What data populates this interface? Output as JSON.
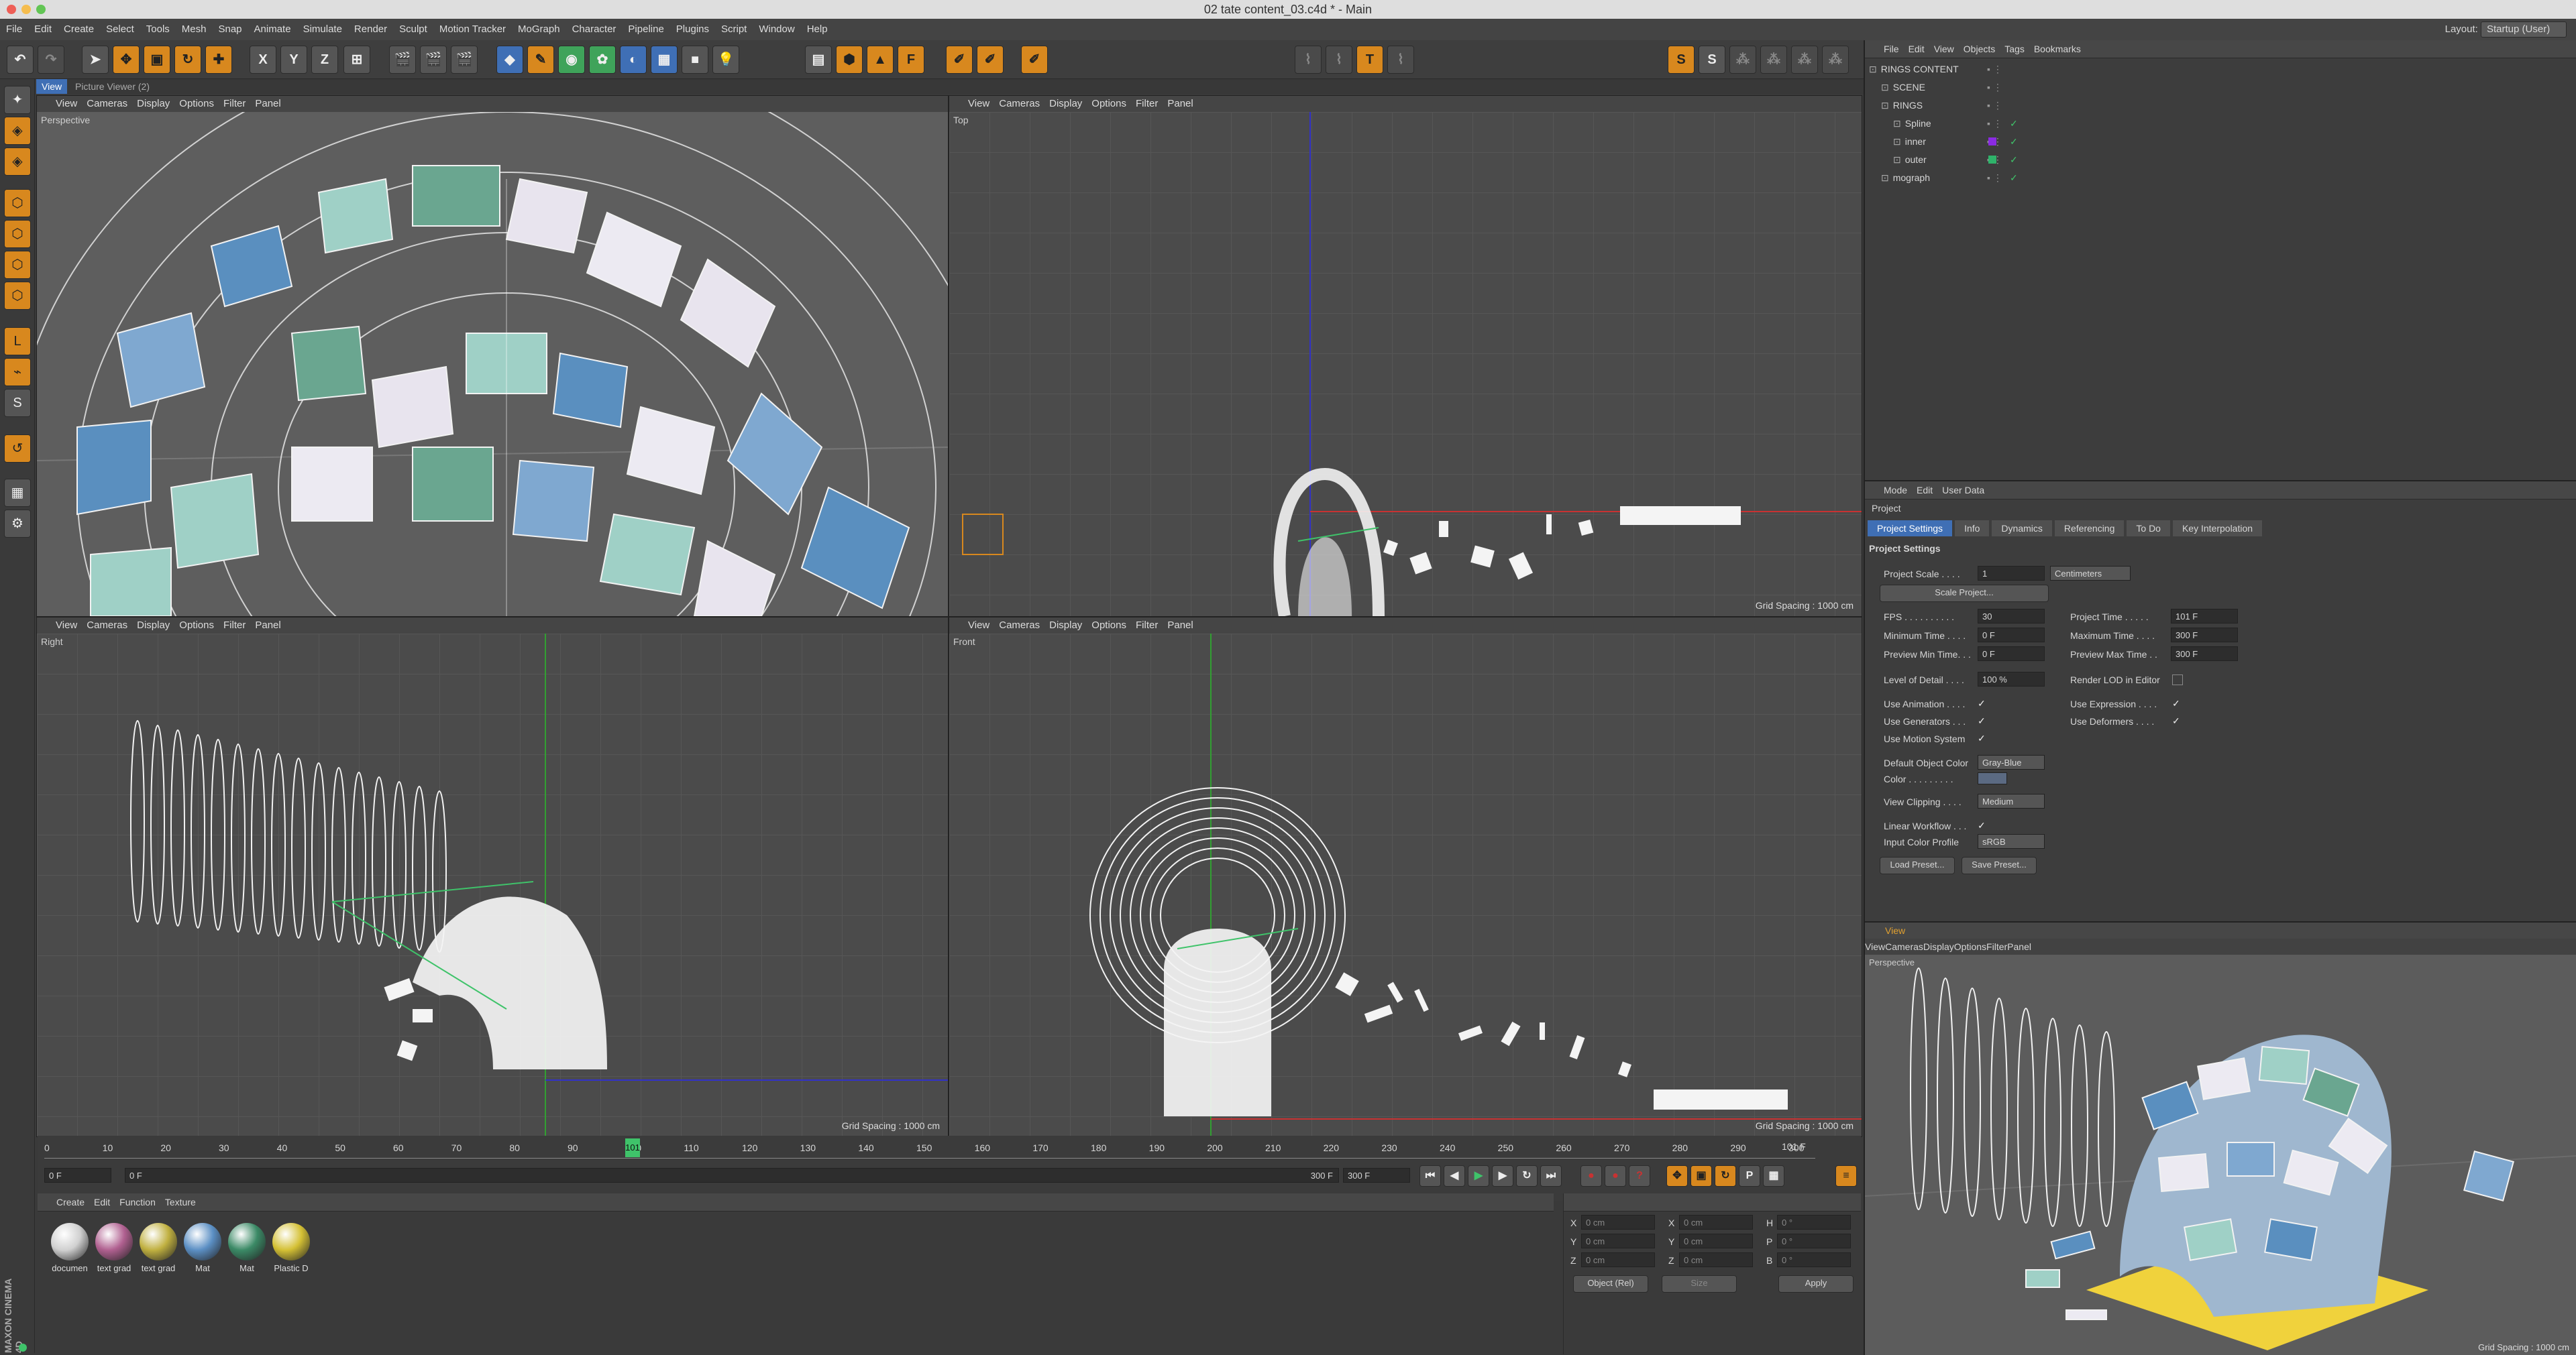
{
  "window": {
    "title": "02 tate content_03.c4d * - Main"
  },
  "menu": {
    "items": [
      "File",
      "Edit",
      "Create",
      "Select",
      "Tools",
      "Mesh",
      "Snap",
      "Animate",
      "Simulate",
      "Render",
      "Sculpt",
      "Motion Tracker",
      "MoGraph",
      "Character",
      "Pipeline",
      "Plugins",
      "Script",
      "Window",
      "Help"
    ],
    "layout_label": "Layout:",
    "layout_value": "Startup (User)"
  },
  "toolbar": {
    "axis_labels": [
      "X",
      "Y",
      "Z"
    ]
  },
  "viewport_tabs": {
    "view": "View",
    "picture_viewer": "Picture Viewer (2)"
  },
  "viewports": [
    {
      "name": "Perspective",
      "menu": [
        "View",
        "Cameras",
        "Display",
        "Options",
        "Filter",
        "Panel"
      ],
      "grid": ""
    },
    {
      "name": "Top",
      "menu": [
        "View",
        "Cameras",
        "Display",
        "Options",
        "Filter",
        "Panel"
      ],
      "grid": "Grid Spacing : 1000 cm"
    },
    {
      "name": "Right",
      "menu": [
        "View",
        "Cameras",
        "Display",
        "Options",
        "Filter",
        "Panel"
      ],
      "grid": "Grid Spacing : 1000 cm"
    },
    {
      "name": "Front",
      "menu": [
        "View",
        "Cameras",
        "Display",
        "Options",
        "Filter",
        "Panel"
      ],
      "grid": "Grid Spacing : 1000 cm"
    }
  ],
  "timeline": {
    "ticks": [
      "0",
      "10",
      "20",
      "30",
      "40",
      "50",
      "60",
      "70",
      "80",
      "90",
      "100",
      "110",
      "120",
      "130",
      "140",
      "150",
      "160",
      "170",
      "180",
      "190",
      "200",
      "210",
      "220",
      "230",
      "240",
      "250",
      "260",
      "270",
      "280",
      "290",
      "300"
    ],
    "current_marker": "101",
    "current_frame": "0 F",
    "start": "0 F",
    "end_field": "300 F",
    "end": "300 F",
    "right_readout": "101 F"
  },
  "materials": {
    "menu": [
      "Create",
      "Edit",
      "Function",
      "Texture"
    ],
    "items": [
      {
        "label": "documen",
        "color": "#d0d0d0"
      },
      {
        "label": "text grad",
        "color": "#b06090"
      },
      {
        "label": "text grad",
        "color": "#c0b040"
      },
      {
        "label": "Mat",
        "color": "#5b8fc4"
      },
      {
        "label": "Mat",
        "color": "#3b8a66"
      },
      {
        "label": "Plastic D",
        "color": "#d4c034"
      }
    ]
  },
  "coords": {
    "rows": [
      [
        "X",
        "0 cm",
        "X",
        "0 cm",
        "H",
        "0 °"
      ],
      [
        "Y",
        "0 cm",
        "Y",
        "0 cm",
        "P",
        "0 °"
      ],
      [
        "Z",
        "0 cm",
        "Z",
        "0 cm",
        "B",
        "0 °"
      ]
    ],
    "mode": "Object (Rel)",
    "size": "Size",
    "apply": "Apply"
  },
  "objects": {
    "menu": [
      "File",
      "Edit",
      "View",
      "Objects",
      "Tags",
      "Bookmarks"
    ],
    "items": [
      {
        "name": "RINGS CONTENT",
        "indent": 0
      },
      {
        "name": "SCENE",
        "indent": 1
      },
      {
        "name": "RINGS",
        "indent": 1
      },
      {
        "name": "Spline",
        "indent": 2
      },
      {
        "name": "inner",
        "indent": 2
      },
      {
        "name": "outer",
        "indent": 2
      },
      {
        "name": "mograph",
        "indent": 1
      }
    ]
  },
  "attributes": {
    "menu": [
      "Mode",
      "Edit",
      "User Data"
    ],
    "title": "Project",
    "tabs": [
      "Project Settings",
      "Info",
      "Dynamics",
      "Referencing",
      "To Do",
      "Key Interpolation"
    ],
    "section": "Project Settings",
    "scale_label": "Project Scale . . . .",
    "scale_value": "1",
    "scale_unit": "Centimeters",
    "scale_button": "Scale Project...",
    "fps_label": "FPS . . . . . . . . . .",
    "fps": "30",
    "project_time_label": "Project Time . . . . .",
    "project_time": "101 F",
    "min_time_label": "Minimum Time . . . .",
    "min_time": "0 F",
    "max_time_label": "Maximum Time . . . .",
    "max_time": "300 F",
    "prev_min_label": "Preview Min Time. . .",
    "prev_min": "0 F",
    "prev_max_label": "Preview Max Time . .",
    "prev_max": "300 F",
    "lod_label": "Level of Detail . . . .",
    "lod": "100 %",
    "render_lod_label": "Render LOD in Editor",
    "use_anim": "Use Animation . . . .",
    "use_expr": "Use Expression . . . .",
    "use_gen": "Use Generators . . .",
    "use_def": "Use Deformers . . . .",
    "use_motion": "Use Motion System",
    "def_color_label": "Default Object Color",
    "def_color": "Gray-Blue",
    "color_label": "Color . . . . . . . . .",
    "clipping_label": "View Clipping . . . .",
    "clipping": "Medium",
    "linear_label": "Linear Workflow . . .",
    "profile_label": "Input Color Profile",
    "profile": "sRGB",
    "load": "Load Preset...",
    "save": "Save Preset..."
  },
  "view_panel": {
    "title": "View",
    "menu": [
      "View",
      "Cameras",
      "Display",
      "Options",
      "Filter",
      "Panel"
    ],
    "name": "Perspective",
    "grid": "Grid Spacing : 1000 cm"
  },
  "brand": {
    "logo": "MAXON CINEMA 4D"
  },
  "colors": {
    "accent": "#3f6fb5",
    "orange": "#d8881e",
    "axis_x": "#c83232",
    "axis_y": "#32a032",
    "axis_z": "#3232c8"
  }
}
